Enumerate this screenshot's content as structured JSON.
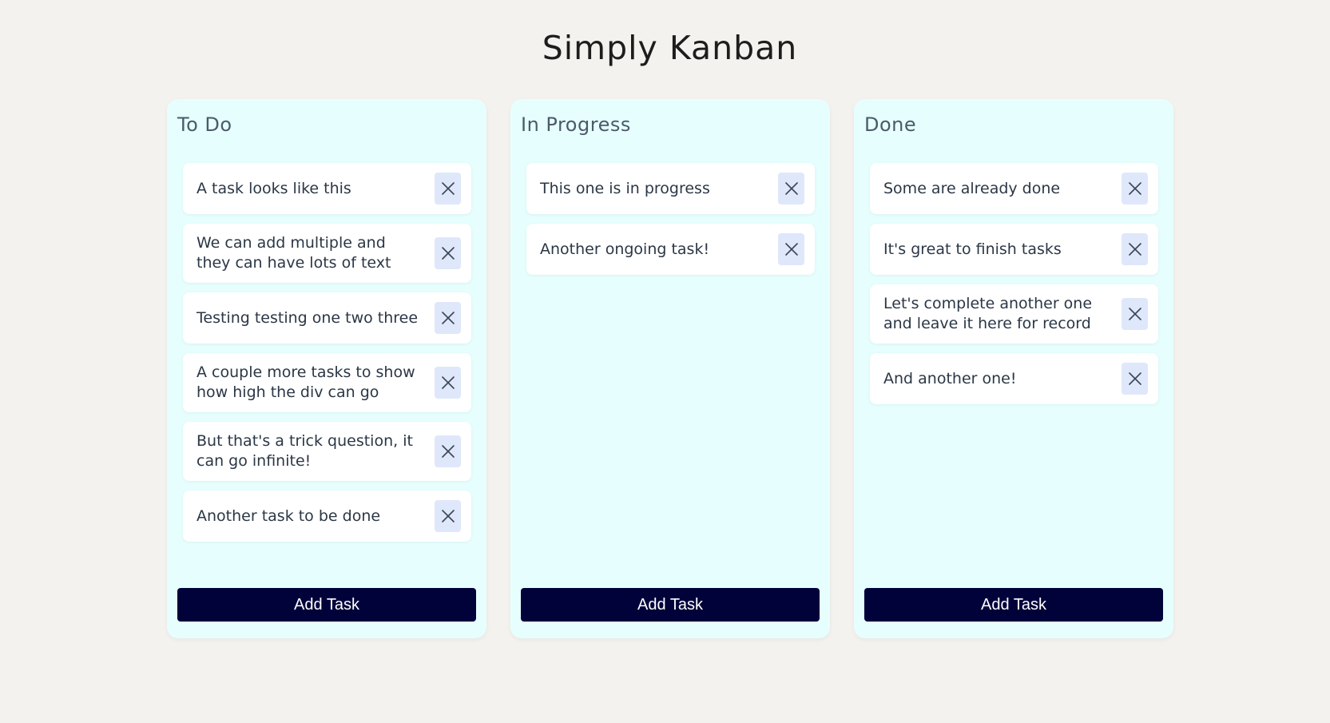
{
  "app": {
    "title": "Simply Kanban"
  },
  "columns": [
    {
      "title": "To Do",
      "tasks": [
        "A task looks like this",
        "We can add multiple and they can have lots of text",
        "Testing testing one two three",
        "A couple more tasks to show how high the div can go",
        "But that's a trick question, it can go infinite!",
        "Another task to be done"
      ],
      "add_label": "Add Task"
    },
    {
      "title": "In Progress",
      "tasks": [
        "This one is in progress",
        "Another ongoing task!"
      ],
      "add_label": "Add Task"
    },
    {
      "title": "Done",
      "tasks": [
        "Some are already done",
        "It's great to finish tasks",
        "Let's complete another one and leave it here for record",
        "And another one!"
      ],
      "add_label": "Add Task"
    }
  ],
  "icons": {
    "delete": "close-icon"
  },
  "colors": {
    "background": "#f4f2ee",
    "column_bg": "#e6fffe",
    "card_bg": "#ffffff",
    "delete_bg": "#dfe7fb",
    "button_bg": "#02023a",
    "button_text": "#ffffff"
  }
}
